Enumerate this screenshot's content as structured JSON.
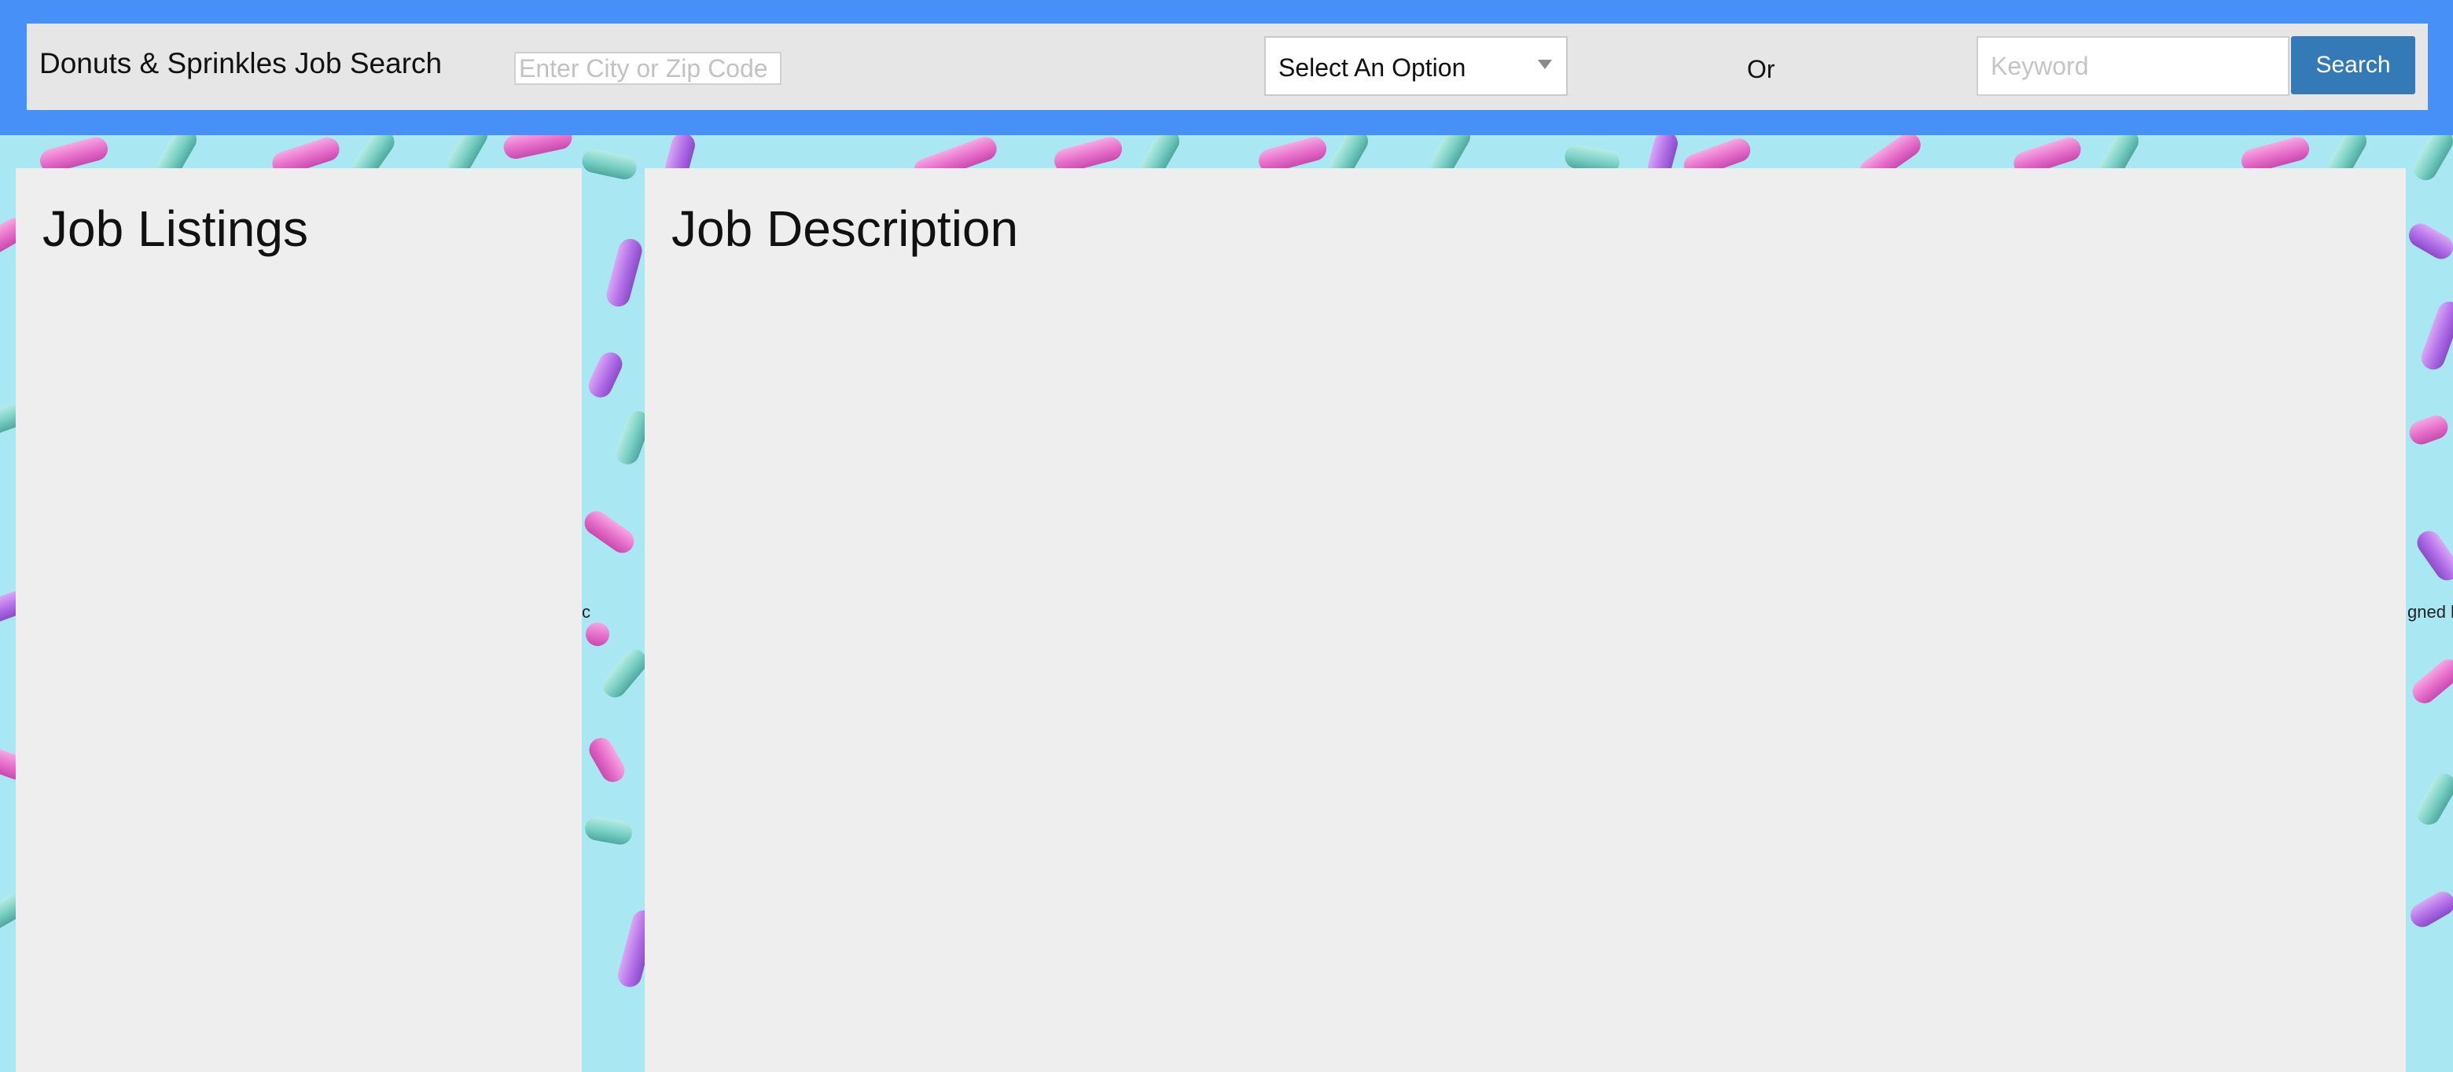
{
  "header": {
    "title": "Donuts & Sprinkles Job Search",
    "location_input": {
      "value": "",
      "placeholder": "Enter City or Zip Code"
    },
    "option_select": {
      "selected": "Select An Option"
    },
    "or_label": "Or",
    "keyword_input": {
      "value": "",
      "placeholder": "Keyword"
    },
    "search_button_label": "Search"
  },
  "panels": {
    "listings": {
      "heading": "Job Listings"
    },
    "description": {
      "heading": "Job Description"
    }
  },
  "background": {
    "fragment_left": "c",
    "fragment_right": "gned b"
  },
  "colors": {
    "header_bar": "#4790f7",
    "header_inner": "#e6e6e6",
    "search_button": "#337ab7",
    "panel": "#eeeeee",
    "background": "#a9e8f2"
  }
}
